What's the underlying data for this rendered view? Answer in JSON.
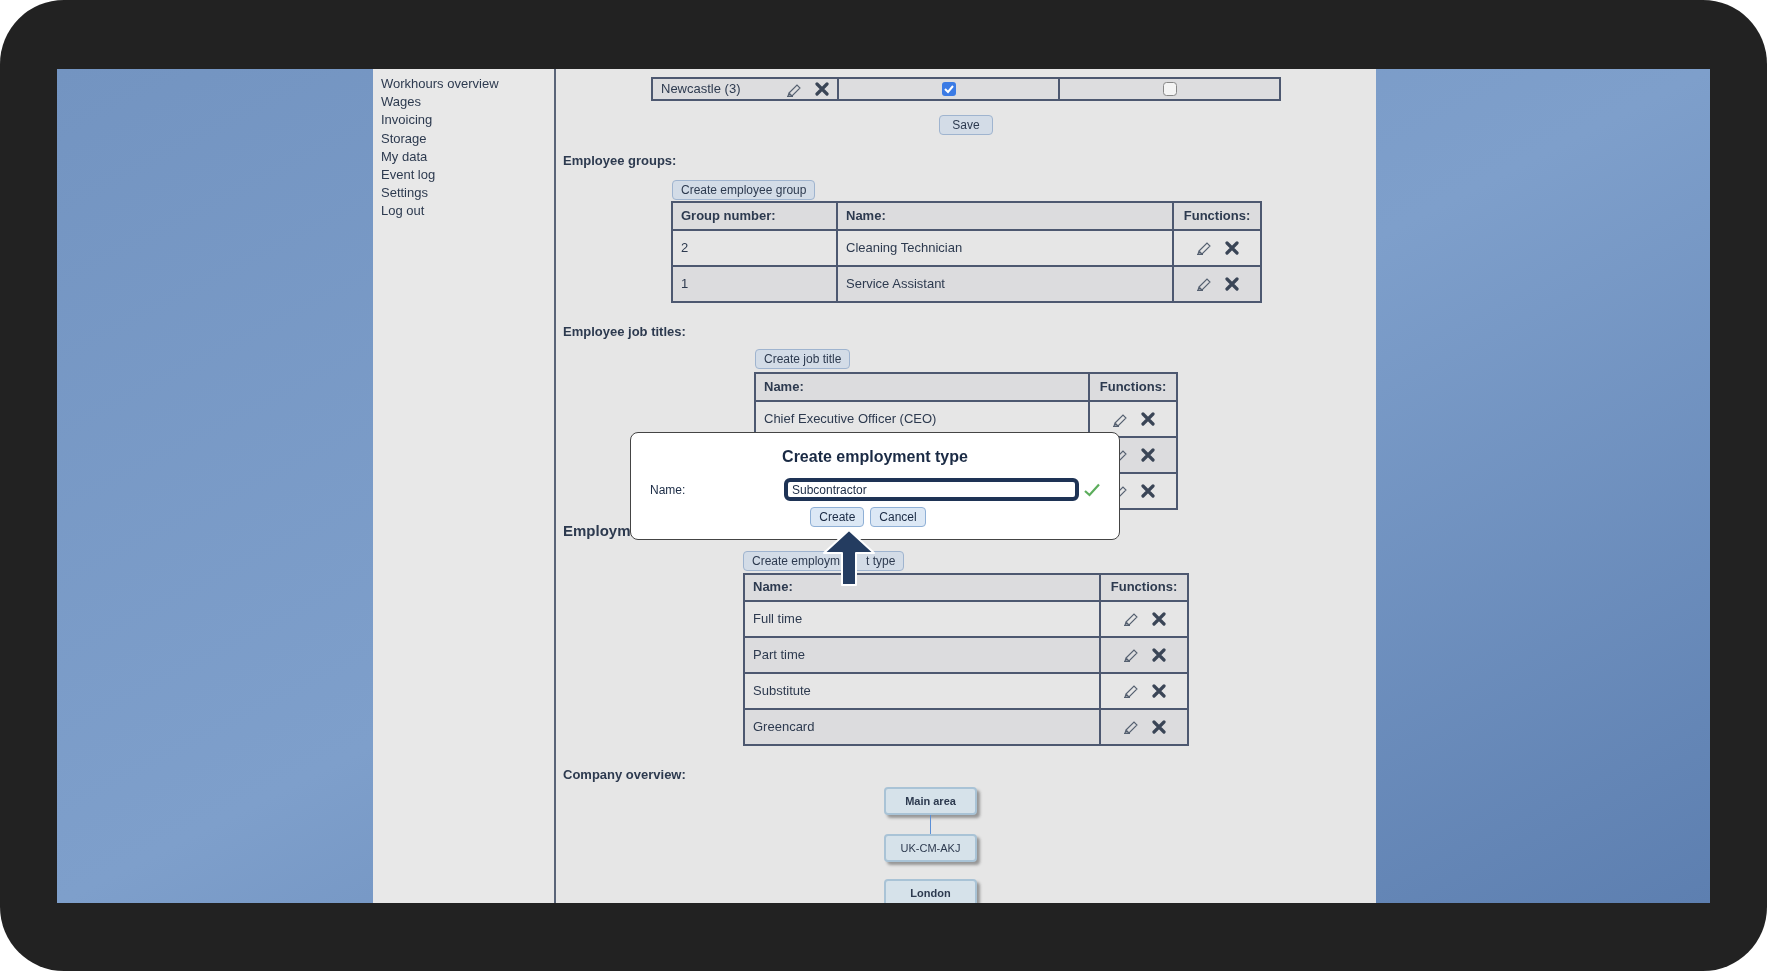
{
  "sidebar": {
    "items": [
      "Workhours overview",
      "Wages",
      "Invoicing",
      "Storage",
      "My data",
      "Event log",
      "Settings",
      "Log out"
    ]
  },
  "locations_table": {
    "rows": [
      {
        "name": "Newcastle (3)",
        "checks": [
          true,
          false
        ]
      }
    ]
  },
  "save_button": "Save",
  "employee_groups": {
    "title": "Employee groups:",
    "create_button": "Create employee group",
    "columns": [
      "Group number:",
      "Name:",
      "Functions:"
    ],
    "rows": [
      {
        "number": "2",
        "name": "Cleaning Technician"
      },
      {
        "number": "1",
        "name": "Service Assistant"
      }
    ]
  },
  "job_titles": {
    "title": "Employee job titles:",
    "create_button": "Create job title",
    "columns": [
      "Name:",
      "Functions:"
    ],
    "rows": [
      {
        "kind": "text",
        "name": "Chief Executive Officer (CEO)"
      },
      {
        "kind": "covered"
      },
      {
        "kind": "covered"
      }
    ]
  },
  "employment_types": {
    "title": "Employm",
    "create_button_parts": [
      "Create employm",
      "t type"
    ],
    "columns": [
      "Name:",
      "Functions:"
    ],
    "rows": [
      {
        "name": "Full time"
      },
      {
        "name": "Part time"
      },
      {
        "name": "Substitute"
      },
      {
        "name": "Greencard"
      }
    ]
  },
  "company_overview": {
    "title": "Company overview:",
    "nodes": [
      {
        "label": "Main area",
        "bold": true
      },
      {
        "label": "UK-CM-AKJ",
        "bold": false
      },
      {
        "label": "London",
        "bold": true
      }
    ]
  },
  "dialog": {
    "title": "Create employment type",
    "field_label": "Name:",
    "value": "Subcontractor",
    "valid": true,
    "buttons": [
      "Create",
      "Cancel"
    ]
  }
}
